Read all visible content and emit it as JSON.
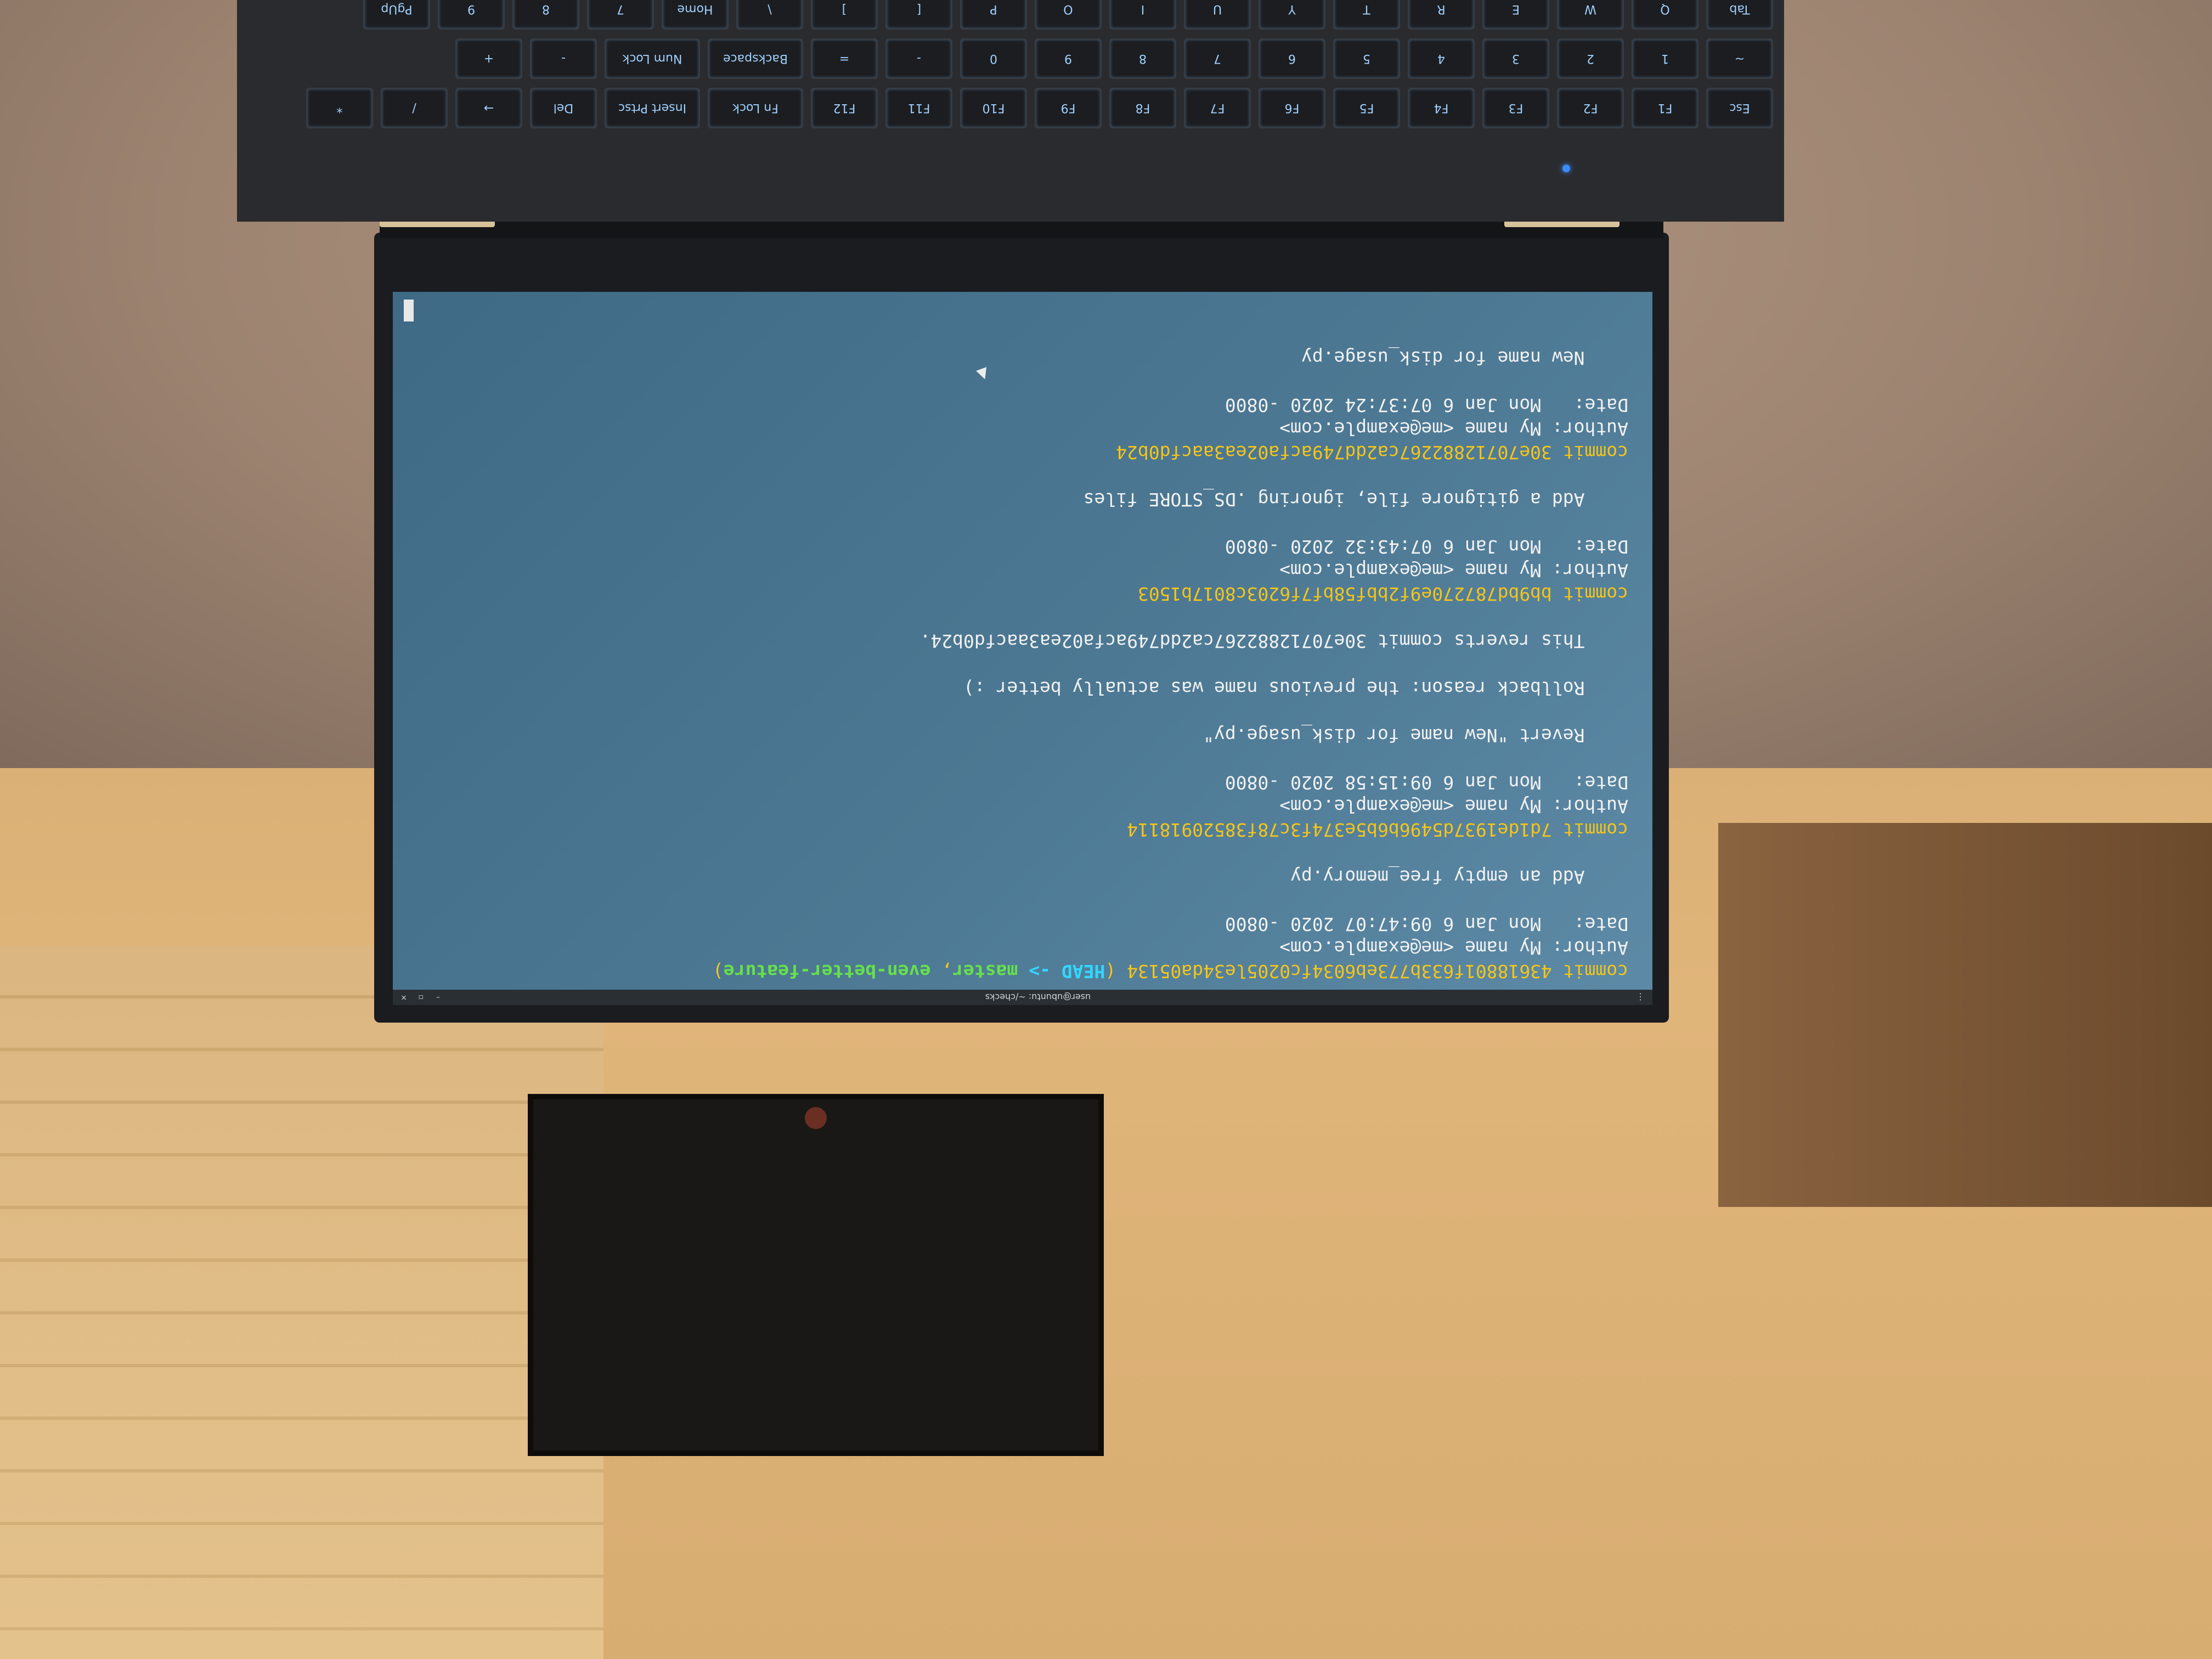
{
  "window": {
    "title": "user@ubuntu: ~/checks"
  },
  "terminal": {
    "commits": [
      {
        "hash_line": "commit 43618801f633b773eb6034fc0205le34da05134",
        "refs_open": "(",
        "head": "HEAD ->",
        "master": "master",
        "sep": ",",
        "branch": "even-better-feature",
        "refs_close": ")",
        "author": "Author: My name <me@example.com>",
        "date": "Date:   Mon Jan 6 09:47:07 2020 -0800",
        "message": [
          "Add an empty free_memory.py"
        ]
      },
      {
        "hash_line": "commit 7d1de1937d5496b6b5e374f3c78f38520918114",
        "author": "Author: My name <me@example.com>",
        "date": "Date:   Mon Jan 6 09:15:58 2020 -0800",
        "message": [
          "Revert \"New name for disk_usage.py\"",
          "",
          "Rollback reason: the previous name was actually better :)",
          "",
          "This reverts commit 30e70712882267ca2dd749acfa02ea3aacfd0b24."
        ]
      },
      {
        "hash_line": "commit bb9bd787270e9f2bbf58bf7f6203c8017b1503",
        "author": "Author: My name <me@example.com>",
        "date": "Date:   Mon Jan 6 07:43:32 2020 -0800",
        "message": [
          "Add a gitignore file, ignoring .DS_STORE files"
        ]
      },
      {
        "hash_line": "commit 30e70712882267ca2dd749acfa02ea3aacfd0b24",
        "author": "Author: My name <me@example.com>",
        "date": "Date:   Mon Jan 6 07:37:24 2020 -0800",
        "message": [
          "New name for disk_usage.py"
        ]
      }
    ],
    "colors": {
      "commit_hash": "#f5c518",
      "head": "#33d6ff",
      "branch": "#66e04a",
      "text": "#f2f2f2"
    }
  },
  "keyboard": {
    "fn_row": [
      "Esc",
      "F1",
      "F2",
      "F3",
      "F4",
      "F5",
      "F6",
      "F7",
      "F8",
      "F9",
      "F10",
      "F11",
      "F12",
      "Fn Lock",
      "Insert Prtsc",
      "Del",
      "→",
      "/",
      "*"
    ],
    "num_row": [
      "~",
      "1",
      "2",
      "3",
      "4",
      "5",
      "6",
      "7",
      "8",
      "9",
      "0",
      "-",
      "=",
      "Backspace",
      "Num Lock",
      "-",
      "+"
    ],
    "qwerty_row": [
      "Tab",
      "Q",
      "W",
      "E",
      "R",
      "T",
      "Y",
      "U",
      "I",
      "O",
      "P",
      "[",
      "]",
      "\\",
      "Home",
      "7",
      "8",
      "9",
      "PgUp"
    ]
  }
}
